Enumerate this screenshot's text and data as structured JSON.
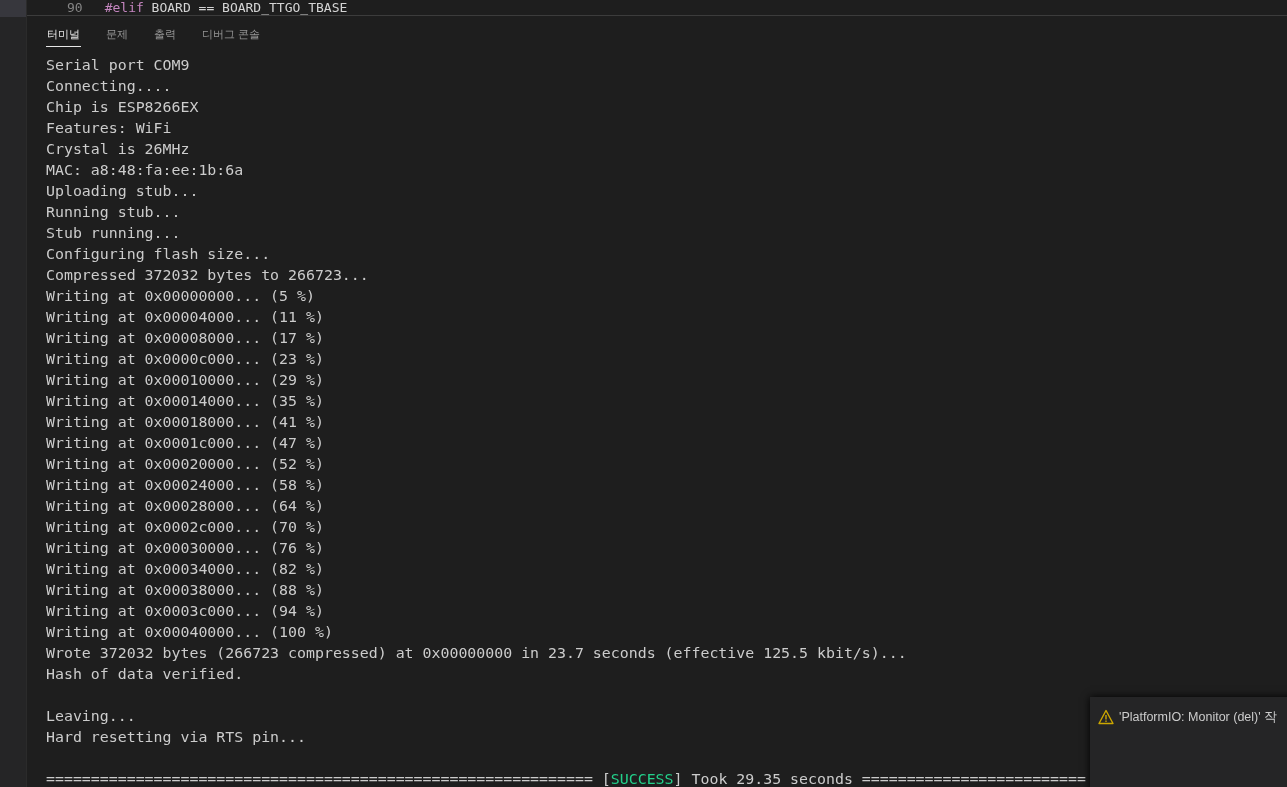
{
  "editor": {
    "line_number": "90",
    "code": "#elif BOARD == BOARD_TTGO_TBASE"
  },
  "tabs": [
    {
      "label": "터미널",
      "selected": true
    },
    {
      "label": "문제",
      "selected": false
    },
    {
      "label": "출력",
      "selected": false
    },
    {
      "label": "디버그 콘솔",
      "selected": false
    }
  ],
  "terminal": {
    "blocks": [
      [
        "Serial port COM9",
        "Connecting....",
        "Chip is ESP8266EX",
        "Features: WiFi",
        "Crystal is 26MHz",
        "MAC: a8:48:fa:ee:1b:6a",
        "Uploading stub...",
        "Running stub...",
        "Stub running...",
        "Configuring flash size...",
        "Compressed 372032 bytes to 266723...",
        "Writing at 0x00000000... (5 %)",
        "Writing at 0x00004000... (11 %)",
        "Writing at 0x00008000... (17 %)",
        "Writing at 0x0000c000... (23 %)",
        "Writing at 0x00010000... (29 %)",
        "Writing at 0x00014000... (35 %)",
        "Writing at 0x00018000... (41 %)",
        "Writing at 0x0001c000... (47 %)",
        "Writing at 0x00020000... (52 %)",
        "Writing at 0x00024000... (58 %)",
        "Writing at 0x00028000... (64 %)",
        "Writing at 0x0002c000... (70 %)",
        "Writing at 0x00030000... (76 %)",
        "Writing at 0x00034000... (82 %)",
        "Writing at 0x00038000... (88 %)",
        "Writing at 0x0003c000... (94 %)",
        "Writing at 0x00040000... (100 %)",
        "Wrote 372032 bytes (266723 compressed) at 0x00000000 in 23.7 seconds (effective 125.5 kbit/s)...",
        "Hash of data verified."
      ],
      [
        "Leaving...",
        "Hard resetting via RTS pin..."
      ]
    ],
    "result": {
      "left_rule": "============================================================= [",
      "status": "SUCCESS",
      "right": "] Took 29.35 seconds ========================="
    }
  },
  "notification": {
    "kind": "warning",
    "message": "'PlatformIO: Monitor (del)' 작"
  }
}
